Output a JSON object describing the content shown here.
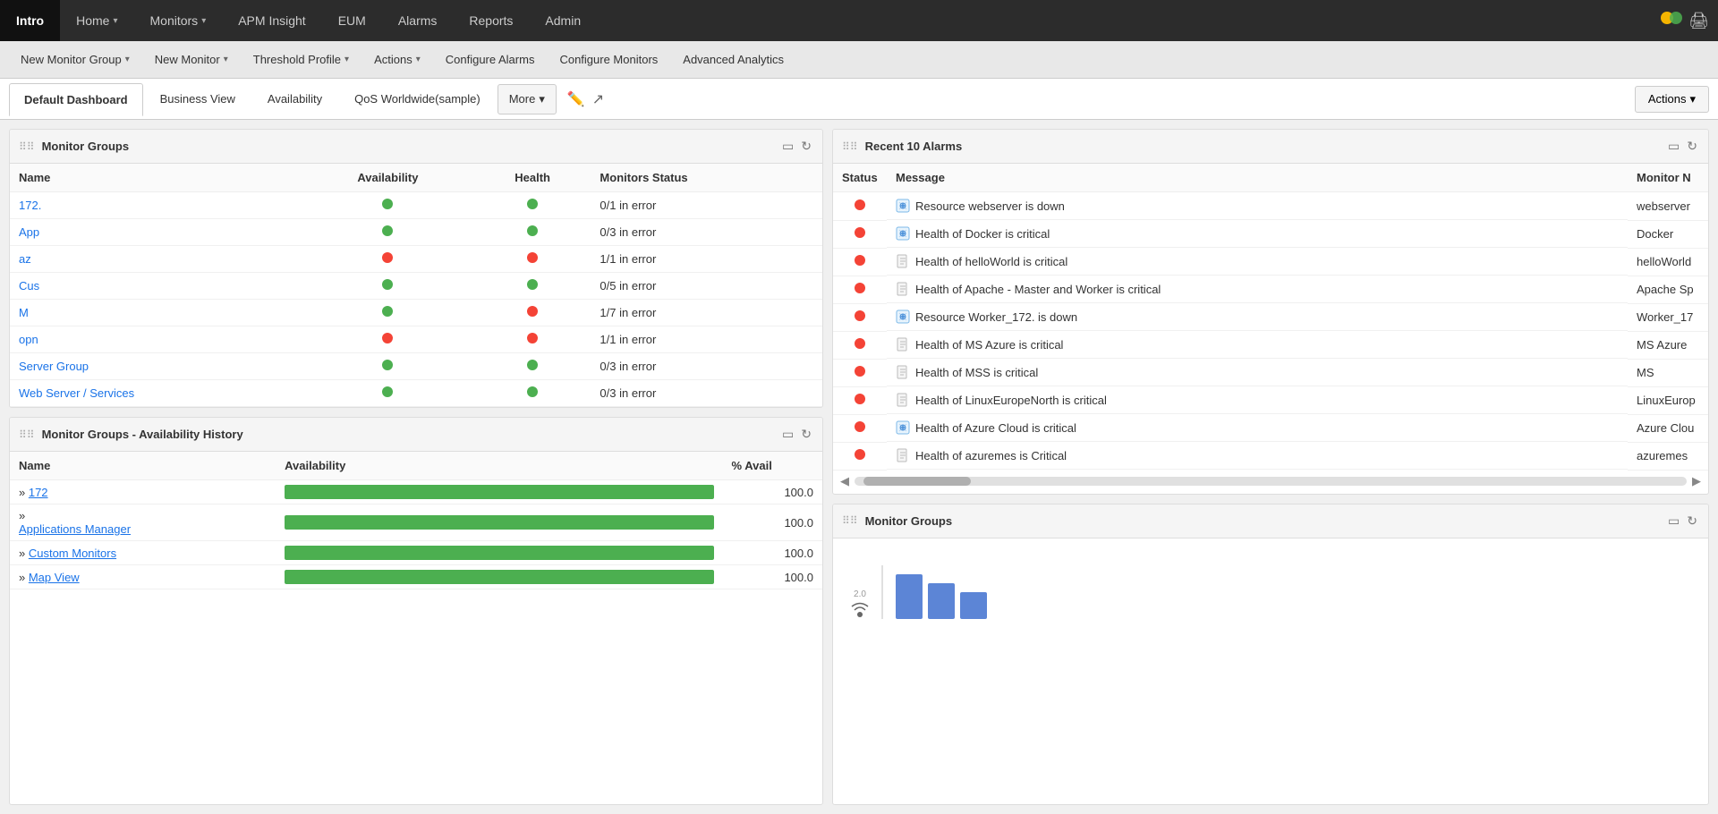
{
  "topnav": {
    "items": [
      {
        "label": "Intro",
        "active": true,
        "has_arrow": false
      },
      {
        "label": "Home",
        "active": false,
        "has_arrow": true
      },
      {
        "label": "Monitors",
        "active": false,
        "has_arrow": true
      },
      {
        "label": "APM Insight",
        "active": false,
        "has_arrow": false
      },
      {
        "label": "EUM",
        "active": false,
        "has_arrow": false
      },
      {
        "label": "Alarms",
        "active": false,
        "has_arrow": false
      },
      {
        "label": "Reports",
        "active": false,
        "has_arrow": false
      },
      {
        "label": "Admin",
        "active": false,
        "has_arrow": false
      }
    ]
  },
  "secondnav": {
    "items": [
      {
        "label": "New Monitor Group",
        "has_arrow": true
      },
      {
        "label": "New Monitor",
        "has_arrow": true
      },
      {
        "label": "Threshold Profile",
        "has_arrow": true
      },
      {
        "label": "Actions",
        "has_arrow": true
      },
      {
        "label": "Configure Alarms",
        "has_arrow": false
      },
      {
        "label": "Configure Monitors",
        "has_arrow": false
      },
      {
        "label": "Advanced Analytics",
        "has_arrow": false
      }
    ]
  },
  "tabs": {
    "items": [
      {
        "label": "Default Dashboard",
        "active": true
      },
      {
        "label": "Business View",
        "active": false
      },
      {
        "label": "Availability",
        "active": false
      },
      {
        "label": "QoS Worldwide(sample)",
        "active": false
      }
    ],
    "more_label": "More",
    "actions_label": "Actions"
  },
  "monitor_groups": {
    "title": "Monitor Groups",
    "columns": [
      "Name",
      "Availability",
      "Health",
      "Monitors Status"
    ],
    "rows": [
      {
        "name": "172.",
        "availability": "green",
        "health": "green",
        "status": "0/1 in error"
      },
      {
        "name": "App",
        "availability": "green",
        "health": "green",
        "status": "0/3 in error"
      },
      {
        "name": "az",
        "availability": "red",
        "health": "red",
        "status": "1/1 in error"
      },
      {
        "name": "Cus",
        "availability": "green",
        "health": "green",
        "status": "0/5 in error"
      },
      {
        "name": "M",
        "availability": "green",
        "health": "red",
        "status": "1/7 in error"
      },
      {
        "name": "opn",
        "availability": "red",
        "health": "red",
        "status": "1/1 in error"
      },
      {
        "name": "Server Group",
        "availability": "green",
        "health": "green",
        "status": "0/3 in error"
      },
      {
        "name": "Web Server / Services",
        "availability": "green",
        "health": "green",
        "status": "0/3 in error"
      }
    ]
  },
  "availability_history": {
    "title": "Monitor Groups - Availability History",
    "columns": [
      "Name",
      "Availability",
      "% Avail"
    ],
    "rows": [
      {
        "name": "172",
        "pct": 100.0,
        "bar_pct": 100
      },
      {
        "name": "Applications Manager",
        "pct": 100.0,
        "bar_pct": 100
      },
      {
        "name": "Custom Monitors",
        "pct": 100.0,
        "bar_pct": 100
      },
      {
        "name": "Map View",
        "pct": 100.0,
        "bar_pct": 100
      }
    ]
  },
  "recent_alarms": {
    "title": "Recent 10 Alarms",
    "columns": [
      "Status",
      "Message",
      "Monitor N"
    ],
    "rows": [
      {
        "status": "red",
        "icon": "link",
        "message": "Resource webserver is down",
        "monitor": "webserver"
      },
      {
        "status": "red",
        "icon": "link",
        "message": "Health of Docker is critical",
        "monitor": "Docker"
      },
      {
        "status": "red",
        "icon": "page",
        "message": "Health of helloWorld is critical",
        "monitor": "helloWorld"
      },
      {
        "status": "red",
        "icon": "page",
        "message": "Health of Apache           - Master and Worker is critical",
        "monitor": "Apache Sp"
      },
      {
        "status": "red",
        "icon": "link",
        "message": "Resource Worker_172.              is down",
        "monitor": "Worker_17"
      },
      {
        "status": "red",
        "icon": "page",
        "message": "Health of MS Azure is critical",
        "monitor": "MS Azure"
      },
      {
        "status": "red",
        "icon": "page",
        "message": "Health of MSS               is critical",
        "monitor": "MS"
      },
      {
        "status": "red",
        "icon": "page",
        "message": "Health of LinuxEuropeNorth is critical",
        "monitor": "LinuxEurop"
      },
      {
        "status": "red",
        "icon": "link",
        "message": "Health of Azure Cloud is critical",
        "monitor": "Azure Clou"
      },
      {
        "status": "red",
        "icon": "page",
        "message": "Health of azuremes is Critical",
        "monitor": "azuremes"
      }
    ]
  },
  "monitor_groups_chart": {
    "title": "Monitor Groups"
  },
  "colors": {
    "green": "#4caf50",
    "red": "#f44336",
    "accent": "#1a73e8"
  }
}
